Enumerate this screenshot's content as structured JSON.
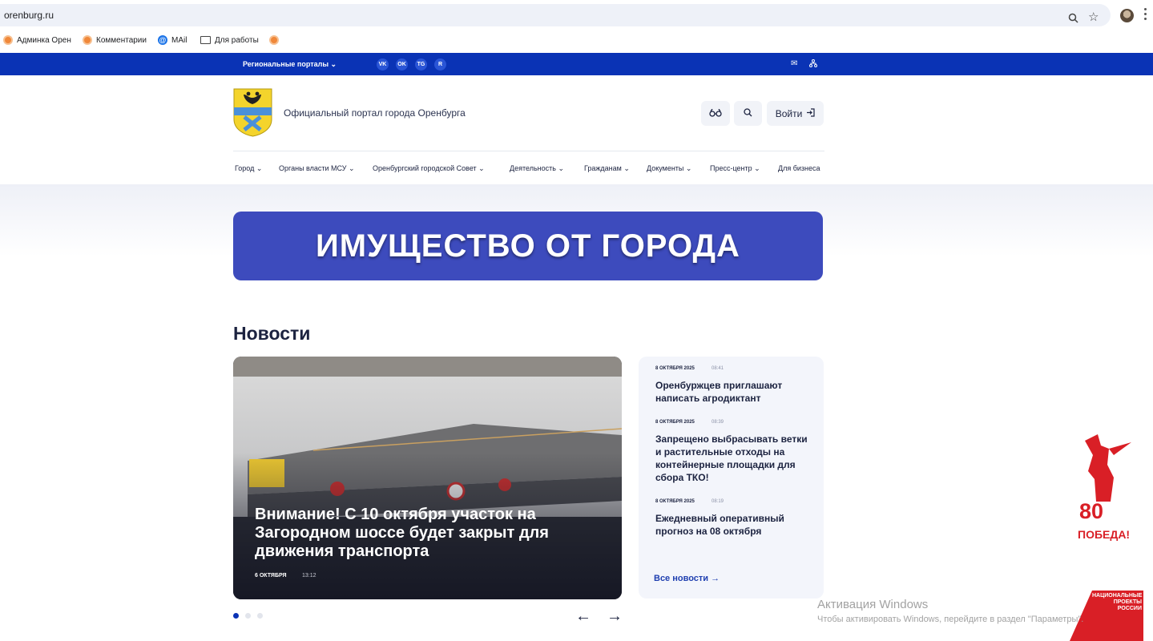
{
  "browser": {
    "url": "orenburg.ru",
    "bookmarks": [
      {
        "label": "Админка Орен",
        "icon": "orange-circle-icon"
      },
      {
        "label": "Комментарии",
        "icon": "orange-circle-icon"
      },
      {
        "label": "MAil",
        "icon": "mail-at-icon"
      },
      {
        "label": "Для работы",
        "icon": "folder-icon"
      }
    ]
  },
  "topbar": {
    "portals_label": "Региональные порталы",
    "social": [
      "VK",
      "OK",
      "TG",
      "R"
    ]
  },
  "header": {
    "title": "Официальный портал города Оренбурга",
    "login_label": "Войти"
  },
  "nav": [
    "Город",
    "Органы власти МСУ",
    "Оренбургский городской Совет",
    "Деятельность",
    "Гражданам",
    "Документы",
    "Пресс-центр",
    "Для бизнеса"
  ],
  "banner": {
    "text": "ИМУЩЕСТВО ОТ ГОРОДА"
  },
  "news": {
    "heading": "Новости",
    "main": {
      "title": "Внимание! С 10 октября участок на Загородном шоссе будет закрыт для движения транспорта",
      "date": "6 ОКТЯБРЯ",
      "time": "13:12"
    },
    "side": [
      {
        "date": "8 ОКТЯБРЯ 2025",
        "time": "08:41",
        "title": "Оренбуржцев приглашают написать агродиктант"
      },
      {
        "date": "8 ОКТЯБРЯ 2025",
        "time": "08:39",
        "title": "Запрещено выбрасывать ветки и растительные отходы на контейнерные площадки для сбора ТКО!"
      },
      {
        "date": "8 ОКТЯБРЯ 2025",
        "time": "08:19",
        "title": "Ежедневный оперативный прогноз на 08 октября"
      }
    ],
    "all_news_label": "Все новости",
    "prev_arrow": "←",
    "next_arrow": "→"
  },
  "overlay": {
    "activation_title": "Активация Windows",
    "activation_text": "Чтобы активировать Windows, перейдите в раздел \"Параметры\".",
    "victory_number": "80",
    "victory_label": "ПОБЕДА!",
    "natproj_lines": [
      "НАЦИОНАЛЬНЫЕ",
      "ПРОЕКТЫ",
      "РОССИИ"
    ]
  }
}
